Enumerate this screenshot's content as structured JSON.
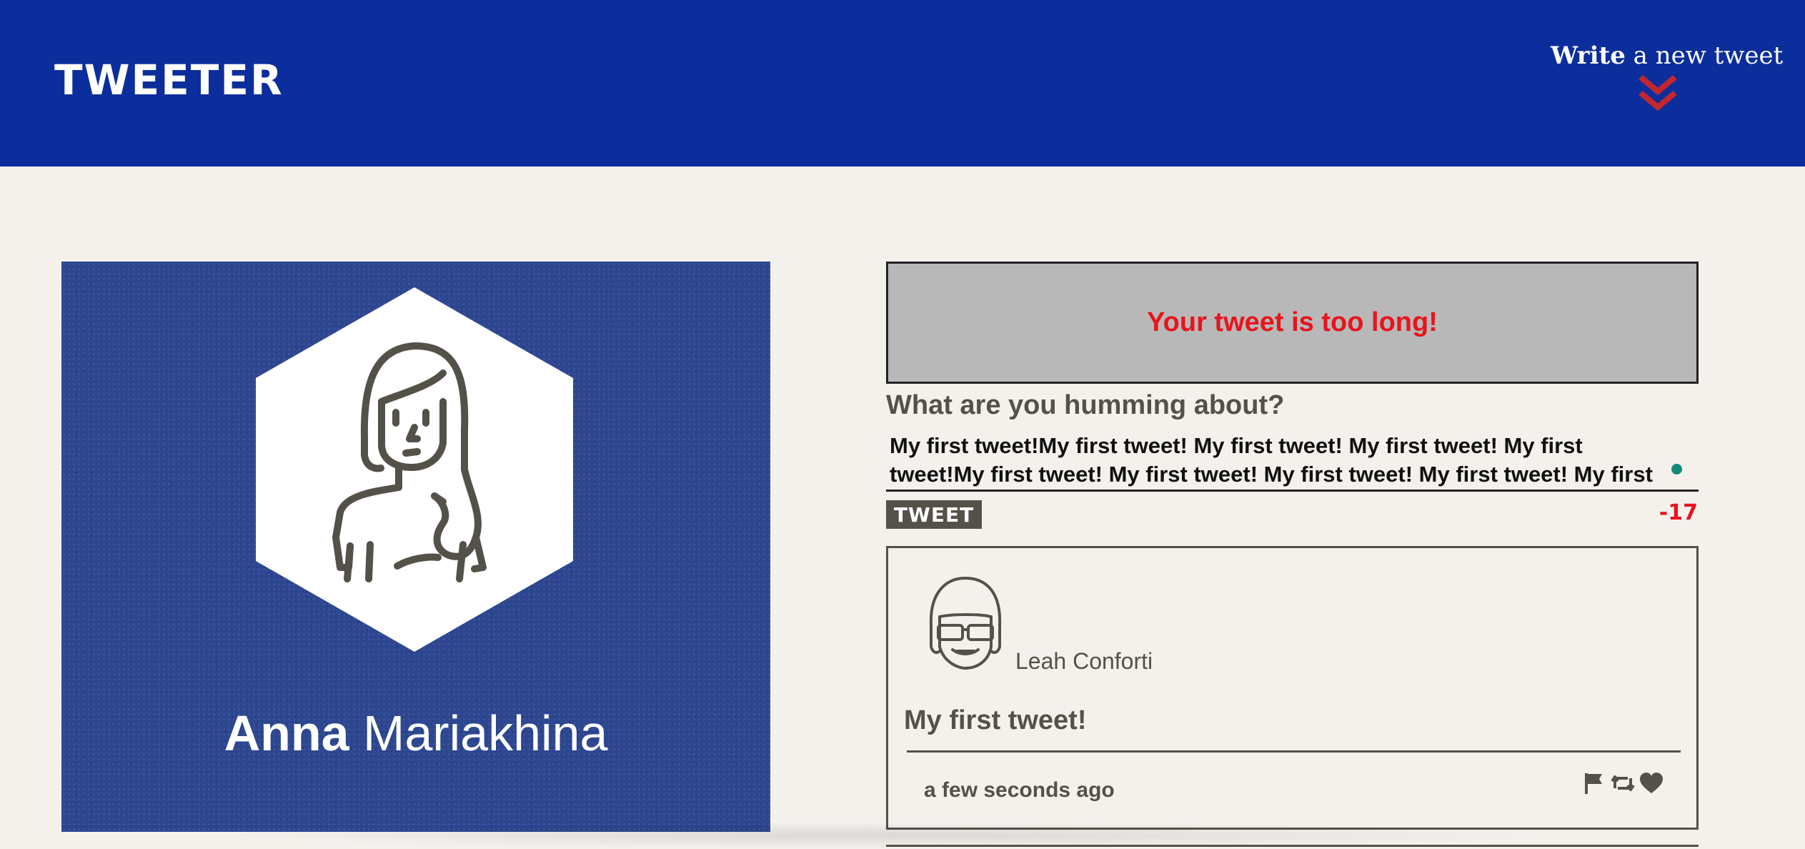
{
  "nav": {
    "logo": "TWEETER",
    "compose_bold": "Write",
    "compose_rest": " a new tweet",
    "compose_icon": "chevron-double-down-icon"
  },
  "profile": {
    "first_name": "Anna",
    "last_name": "Mariakhina",
    "avatar_icon": "user-avatar-icon"
  },
  "composer": {
    "error": "Your tweet is too long!",
    "label": "What are you humming about?",
    "text": "My first tweet!My first tweet! My first tweet! My first tweet! My first tweet!My first tweet! My first tweet! My first tweet! My first tweet! My first tweet!",
    "button": "TWEET",
    "counter": "-17"
  },
  "tweets": [
    {
      "author": "Leah Conforti",
      "content": "My first tweet!",
      "time": "a few seconds ago",
      "actions": [
        "flag-icon",
        "retweet-icon",
        "heart-icon"
      ]
    }
  ],
  "colors": {
    "nav_bg": "#0c2e9c",
    "page_bg": "#f4f1ed",
    "text": "#545149",
    "error": "#e8141c",
    "chevron": "#c4262e",
    "error_box_bg": "#b8b8b8"
  }
}
